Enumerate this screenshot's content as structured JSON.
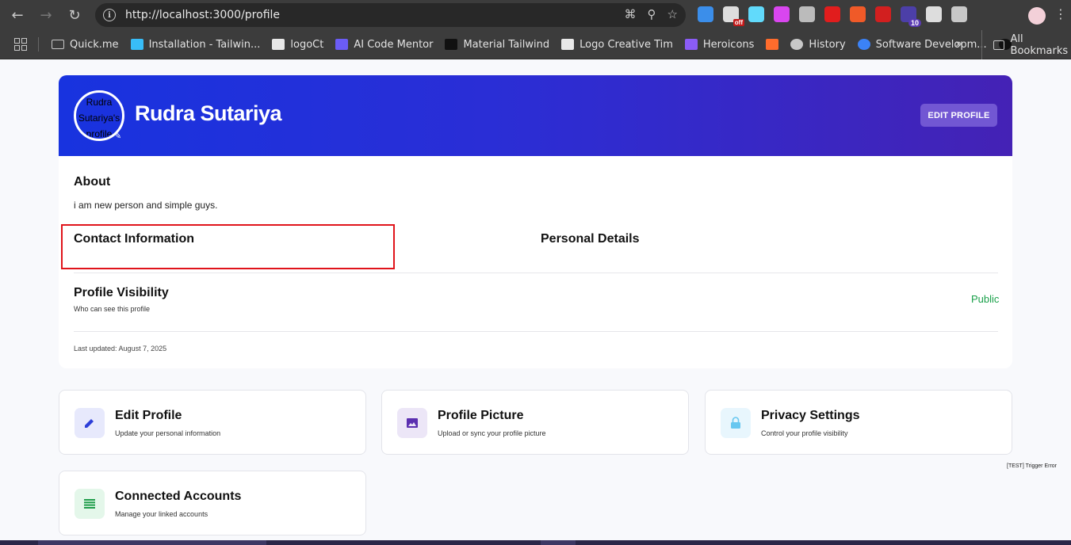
{
  "browser": {
    "url": "http://localhost:3000/profile",
    "bookmarks": [
      {
        "label": "Quick.me",
        "icon": "folder-icon",
        "color": "#c8c8c8"
      },
      {
        "label": "Installation - Tailwin...",
        "icon": "tailwind-icon",
        "color": "#38bdf8"
      },
      {
        "label": "logoCt",
        "icon": "logo-icon",
        "color": "#e8e8e8"
      },
      {
        "label": "AI Code Mentor",
        "icon": "ai-icon",
        "color": "#6b5cf5"
      },
      {
        "label": "Material Tailwind",
        "icon": "material-icon",
        "color": "#111111"
      },
      {
        "label": "Logo Creative Tim",
        "icon": "logo-icon",
        "color": "#e8e8e8"
      },
      {
        "label": "Heroicons",
        "icon": "shield-icon",
        "color": "#8b5cf6"
      },
      {
        "label": "",
        "icon": "cpanel-icon",
        "color": "#ff6c2c"
      },
      {
        "label": "History",
        "icon": "history-icon",
        "color": "#c8c8c8"
      },
      {
        "label": "Software Developm...",
        "icon": "globe-icon",
        "color": "#3b82f6"
      },
      {
        "label": "",
        "icon": "triangle-icon",
        "color": "#111111"
      }
    ],
    "all_bookmarks": "All Bookmarks",
    "extensions": [
      {
        "name": "colorzilla-icon",
        "color": "#3b8eea"
      },
      {
        "name": "mail-off-icon",
        "color": "#dddddd",
        "badge": "off"
      },
      {
        "name": "react-icon",
        "color": "#61dafb"
      },
      {
        "name": "palette-icon",
        "color": "#d946ef"
      },
      {
        "name": "camera-icon",
        "color": "#bbbbbb"
      },
      {
        "name": "stop-hand-icon",
        "color": "#e11d1d"
      },
      {
        "name": "api-icon",
        "color": "#f05a28"
      },
      {
        "name": "pdf-icon",
        "color": "#d21f1f"
      },
      {
        "name": "grammar-icon",
        "color": "#4c3fa8",
        "badge": "10"
      },
      {
        "name": "eyedropper-icon",
        "color": "#dddddd"
      },
      {
        "name": "puzzle-icon",
        "color": "#c8c8c8"
      }
    ]
  },
  "profile": {
    "avatar_alt": "Rudra Sutariya's profile",
    "name": "Rudra Sutariya",
    "edit_button": "EDIT PROFILE",
    "about_title": "About",
    "about_text": "i am new person and simple guys.",
    "contact_title": "Contact Information",
    "personal_title": "Personal Details",
    "visibility_title": "Profile Visibility",
    "visibility_sub": "Who can see this profile",
    "visibility_value": "Public",
    "last_updated": "Last updated: August 7, 2025"
  },
  "actions": [
    {
      "title": "Edit Profile",
      "sub": "Update your personal information",
      "icon": "pencil-icon",
      "icon_color": "#2c3ed8",
      "bg": "#e7e9fc"
    },
    {
      "title": "Profile Picture",
      "sub": "Upload or sync your profile picture",
      "icon": "image-icon",
      "icon_color": "#5b2fb0",
      "bg": "#ece6f7"
    },
    {
      "title": "Privacy Settings",
      "sub": "Control your profile visibility",
      "icon": "lock-icon",
      "icon_color": "#67c7f0",
      "bg": "#e8f6fd"
    },
    {
      "title": "Connected Accounts",
      "sub": "Manage your linked accounts",
      "icon": "list-icon",
      "icon_color": "#1f9d4a",
      "bg": "#e4f7ea"
    }
  ],
  "debug": {
    "trigger_error": "[TEST] Trigger Error"
  }
}
